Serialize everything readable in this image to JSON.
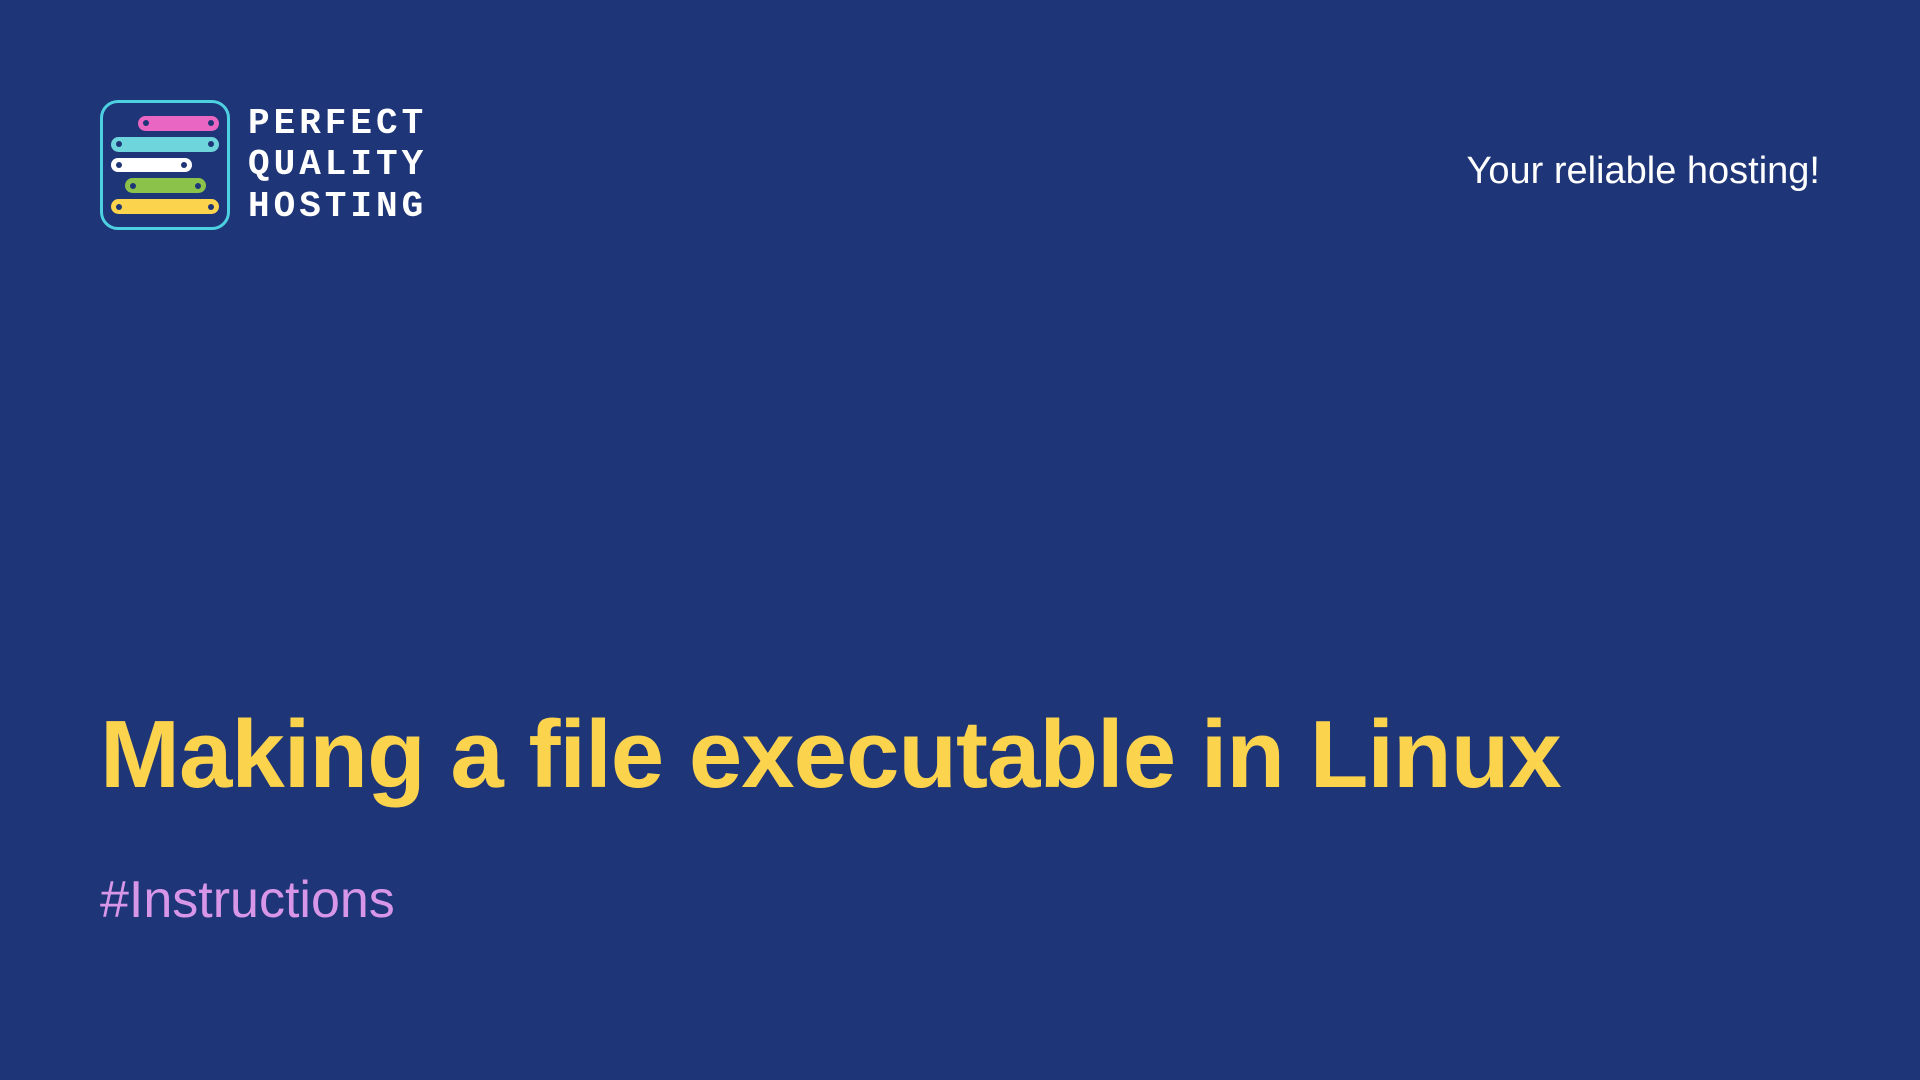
{
  "logo": {
    "line1": "Perfect",
    "line2": "Quality",
    "line3": "Hosting"
  },
  "tagline": "Your reliable hosting!",
  "title": "Making a file executable in Linux",
  "category": "#Instructions"
}
